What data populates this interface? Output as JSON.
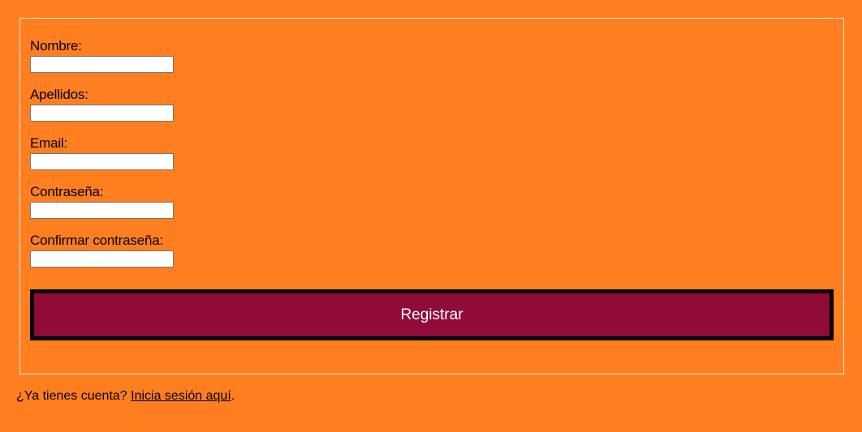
{
  "form": {
    "fields": [
      {
        "label": "Nombre:",
        "value": ""
      },
      {
        "label": "Apellidos:",
        "value": ""
      },
      {
        "label": "Email:",
        "value": ""
      },
      {
        "label": "Contraseña:",
        "value": ""
      },
      {
        "label": "Confirmar contraseña:",
        "value": ""
      }
    ],
    "submit_label": "Registrar"
  },
  "footer": {
    "prompt": "¿Ya tienes cuenta? ",
    "link_text": "Inicia sesión aquí",
    "suffix": "."
  },
  "colors": {
    "background": "#ff7f20",
    "button_background": "#900a3a",
    "button_border": "#000000",
    "button_text": "#ffffff"
  }
}
